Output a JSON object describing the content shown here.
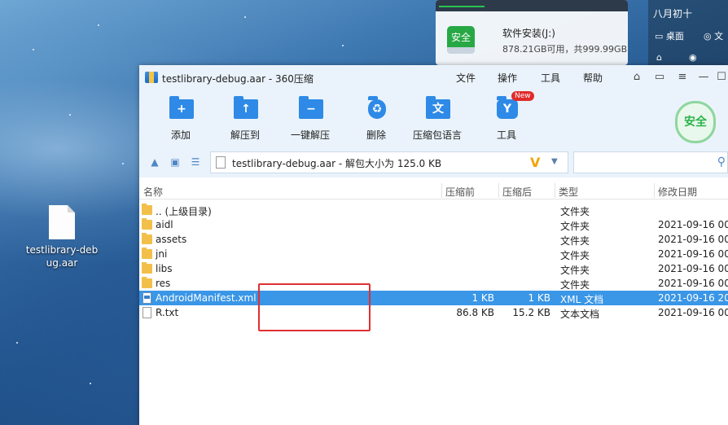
{
  "desktop": {
    "file_label": "testlibrary-debug.aar"
  },
  "disk_widget": {
    "icon_text": "安全",
    "name": "软件安装(J:)",
    "info": "878.21GB可用，共999.99GB"
  },
  "calendar_widget": {
    "date": "八月初十",
    "item1": "桌面",
    "item2": "文"
  },
  "window": {
    "title": "testlibrary-debug.aar - 360压缩",
    "menu": [
      "文件",
      "操作",
      "工具",
      "帮助"
    ],
    "toolbar": [
      {
        "label": "添加",
        "icon": "add-icon"
      },
      {
        "label": "解压到",
        "icon": "extract-to-icon"
      },
      {
        "label": "一键解压",
        "icon": "one-click-extract-icon"
      },
      {
        "label": "删除",
        "icon": "delete-icon"
      },
      {
        "label": "压缩包语言",
        "icon": "language-icon"
      },
      {
        "label": "工具",
        "icon": "tools-icon",
        "badge": "New"
      }
    ],
    "security_badge": "安全",
    "path": "testlibrary-debug.aar - 解包大小为 125.0 KB",
    "columns": {
      "name": "名称",
      "packed": "压缩前",
      "unpacked": "压缩后",
      "type": "类型",
      "modified": "修改日期"
    },
    "rows": [
      {
        "name": ".. (上级目录)",
        "packed": "",
        "unpacked": "",
        "type": "文件夹",
        "modified": "",
        "kind": "folder"
      },
      {
        "name": "aidl",
        "packed": "",
        "unpacked": "",
        "type": "文件夹",
        "modified": "2021-09-16 00:",
        "kind": "folder"
      },
      {
        "name": "assets",
        "packed": "",
        "unpacked": "",
        "type": "文件夹",
        "modified": "2021-09-16 00:",
        "kind": "folder"
      },
      {
        "name": "jni",
        "packed": "",
        "unpacked": "",
        "type": "文件夹",
        "modified": "2021-09-16 00:",
        "kind": "folder"
      },
      {
        "name": "libs",
        "packed": "",
        "unpacked": "",
        "type": "文件夹",
        "modified": "2021-09-16 00:",
        "kind": "folder"
      },
      {
        "name": "res",
        "packed": "",
        "unpacked": "",
        "type": "文件夹",
        "modified": "2021-09-16 00:",
        "kind": "folder"
      },
      {
        "name": "AndroidManifest.xml",
        "packed": "1 KB",
        "unpacked": "1 KB",
        "type": "XML 文档",
        "modified": "2021-09-16 20:",
        "kind": "xml",
        "selected": true
      },
      {
        "name": "R.txt",
        "packed": "86.8 KB",
        "unpacked": "15.2 KB",
        "type": "文本文档",
        "modified": "2021-09-16 00:",
        "kind": "txt"
      }
    ]
  },
  "colors": {
    "selection": "#3a96e6",
    "annotation": "#e03030",
    "toolbar_bg": "#eaf3fb"
  }
}
